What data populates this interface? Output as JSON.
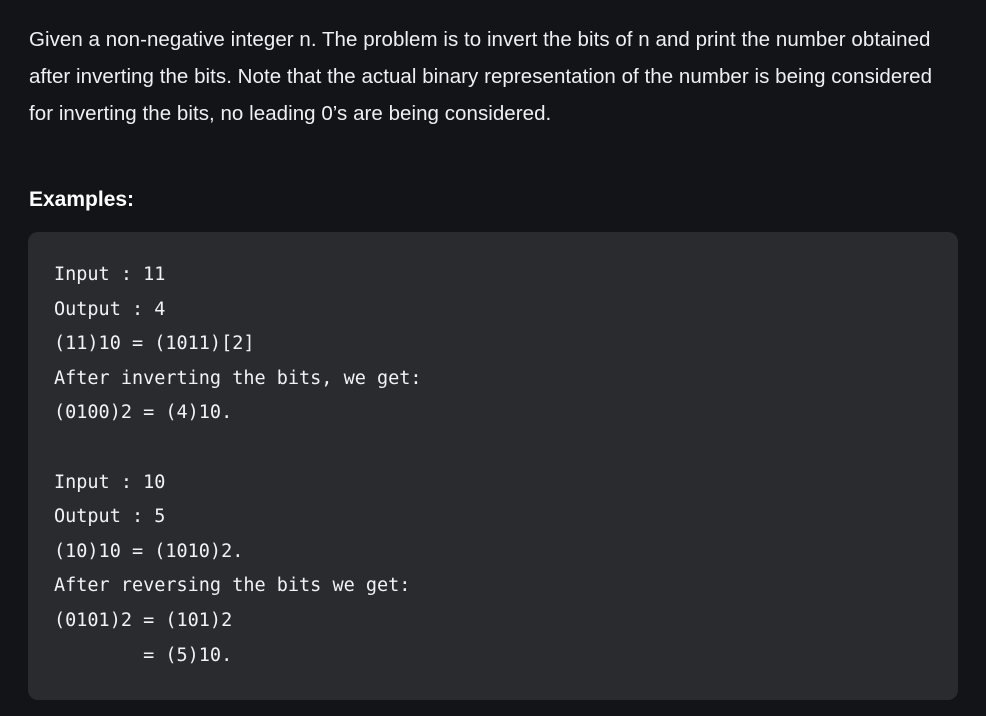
{
  "intro": {
    "text": "Given a non-negative integer n. The problem is to invert the bits of n and print the number obtained after inverting the bits. Note that the actual binary representation of the number is being considered for inverting the bits, no leading 0’s are being considered."
  },
  "examples": {
    "heading": "Examples:",
    "lines": [
      "Input : 11",
      "Output : 4",
      "(11)10 = (1011)[2]",
      "After inverting the bits, we get:",
      "(0100)2 = (4)10.",
      "",
      "Input : 10",
      "Output : 5",
      "(10)10 = (1010)2.",
      "After reversing the bits we get:",
      "(0101)2 = (101)2",
      "        = (5)10."
    ]
  }
}
